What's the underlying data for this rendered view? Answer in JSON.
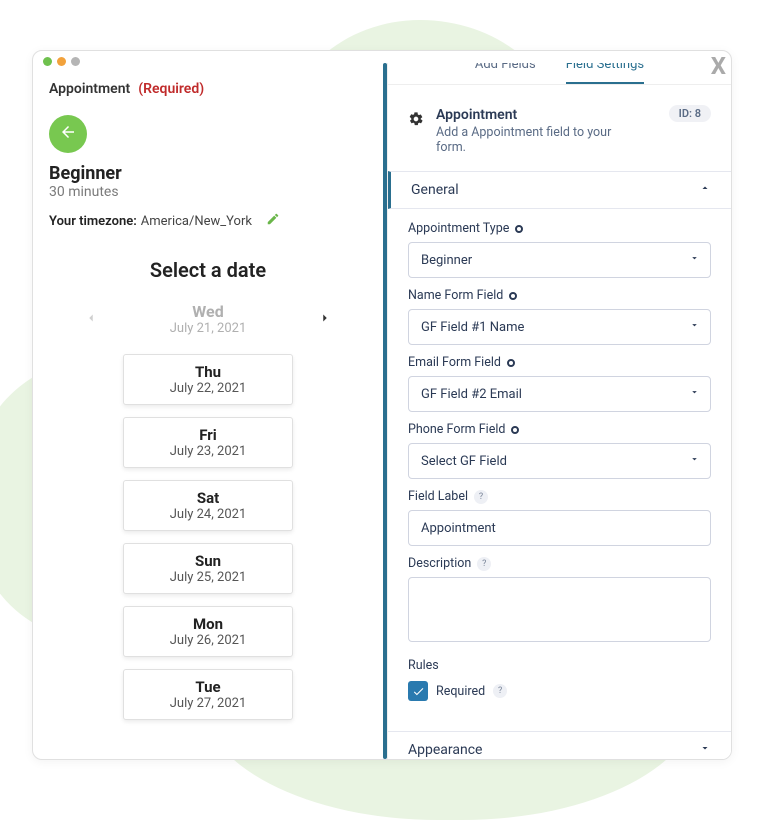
{
  "close_x": "X",
  "left": {
    "header_label": "Appointment",
    "header_required": "(Required)",
    "title": "Beginner",
    "duration": "30 minutes",
    "tz_label": "Your timezone:",
    "tz_value": "America/New_York",
    "select_date": "Select a date",
    "current": {
      "day": "Wed",
      "date": "July 21, 2021"
    },
    "dates": [
      {
        "day": "Thu",
        "date": "July 22, 2021"
      },
      {
        "day": "Fri",
        "date": "July 23, 2021"
      },
      {
        "day": "Sat",
        "date": "July 24, 2021"
      },
      {
        "day": "Sun",
        "date": "July 25, 2021"
      },
      {
        "day": "Mon",
        "date": "July 26, 2021"
      },
      {
        "day": "Tue",
        "date": "July 27, 2021"
      }
    ]
  },
  "right": {
    "tabs": {
      "add_fields": "Add Fields",
      "field_settings": "Field Settings"
    },
    "info": {
      "title": "Appointment",
      "desc": "Add a Appointment field to your form.",
      "id_badge": "ID: 8"
    },
    "sections": {
      "general": "General",
      "appearance": "Appearance"
    },
    "labels": {
      "appointment_type": "Appointment Type",
      "name_form_field": "Name Form Field",
      "email_form_field": "Email Form Field",
      "phone_form_field": "Phone Form Field",
      "field_label": "Field Label",
      "description": "Description",
      "rules": "Rules",
      "required": "Required"
    },
    "values": {
      "appointment_type": "Beginner",
      "name_form_field": "GF Field #1 Name",
      "email_form_field": "GF Field #2 Email",
      "phone_form_field": "Select GF Field",
      "field_label": "Appointment",
      "description": "",
      "required_checked": true
    }
  }
}
